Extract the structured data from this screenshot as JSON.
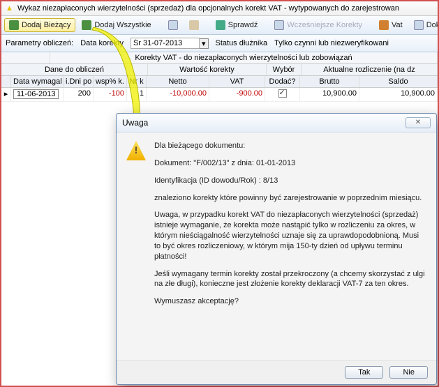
{
  "window": {
    "title": "Wykaz niezapłaconych wierzytelności (sprzedaż) dla opcjonalnych korekt VAT - wytypowanych do zarejestrowan"
  },
  "toolbar": {
    "dodaj_biezacy": "Dodaj Bieżący",
    "dodaj_wszystkie": "Dodaj Wszystkie",
    "sprawdz": "Sprawdź",
    "wczesniejsze": "Wcześniejsze Korekty",
    "vat": "Vat",
    "dokume": "Dokume"
  },
  "params": {
    "label": "Parametry obliczeń:",
    "data_korekty_label": "Data korekty",
    "data_korekty_value": "Śr 31-07-2013",
    "status_label": "Status dłużnika",
    "status_value": "Tylko czynni lub niezweryfikowani"
  },
  "grid": {
    "top_header": "Korekty VAT - do niezapłaconych wierzytelności lub zobowiązań",
    "groups": {
      "dane": "Dane do obliczeń",
      "wartosc": "Wartość korekty",
      "wybor": "Wybór",
      "aktualne": "Aktualne rozliczenie (na dz"
    },
    "cols": {
      "data_wymagal": "Data wymagal",
      "dni_po": "i.Dni po",
      "wsp_k": "wsp% k.",
      "nrk": "Nr k",
      "netto": "Netto",
      "vat": "VAT",
      "dodac": "Dodać?",
      "brutto": "Brutto",
      "saldo": "Saldo"
    },
    "row": {
      "data_wymagal": "11-06-2013",
      "dni_po": "200",
      "wsp_k": "-100",
      "nrk": "1",
      "netto": "-10,000.00",
      "vat": "-900.00",
      "dodac_checked": true,
      "brutto": "10,900.00",
      "saldo": "10,900.00"
    }
  },
  "dialog": {
    "title": "Uwaga",
    "line1": "Dla bieżącego dokumentu:",
    "line2": "Dokument: \"F/002/13\"  z dnia:  01-01-2013",
    "line3": "Identyfikacja (ID dowodu/Rok) :  8/13",
    "line4": "znaleziono korekty które powinny być zarejestrowanie w poprzednim miesiącu.",
    "line5": "Uwaga, w przypadku korekt VAT do niezapłaconych wierzytelności (sprzedaż) istnieje wymaganie, że korekta może nastąpić tylko w rozliczeniu za okres, w którym nieściągalność wierzytelności uznaje się za uprawdopodobnioną. Musi to być okres rozliczeniowy, w którym mija 150-ty dzień od upływu terminu płatności!",
    "line6": "Jeśli wymagany termin korekty został przekroczony (a chcemy skorzystać z ulgi na złe długi), konieczne jest złożenie korekty deklaracji VAT-7 za ten okres.",
    "line7": "Wymuszasz akceptację?",
    "btn_yes": "Tak",
    "btn_no": "Nie"
  }
}
